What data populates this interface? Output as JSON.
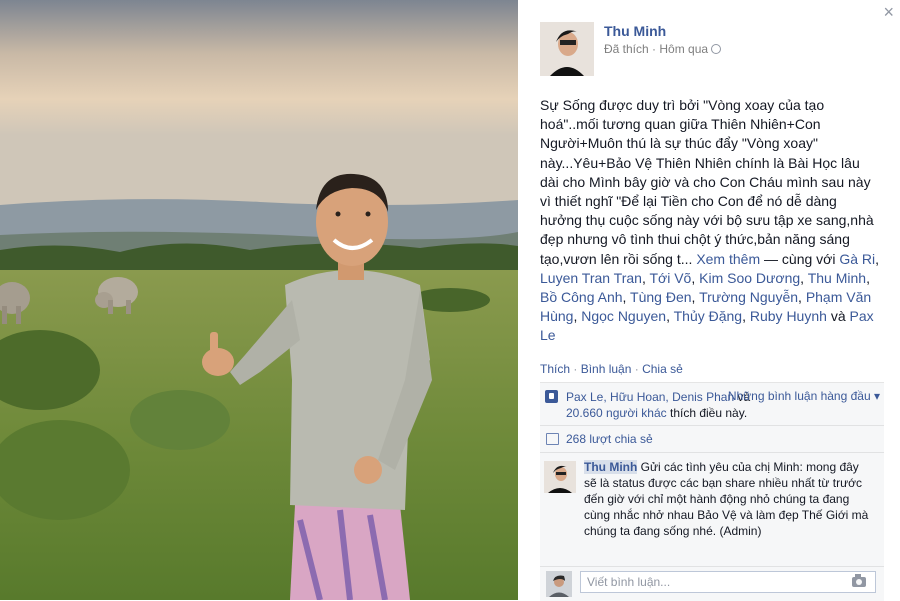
{
  "post": {
    "author": "Thu Minh",
    "liked": "Đã thích",
    "separator": " · ",
    "time": "Hôm qua",
    "body_text": "Sự Sống được duy trì bởi \"Vòng xoay của tạo hoá\"..mối tương quan giữa Thiên Nhiên+Con Người+Muôn thú là sự thúc đẩy \"Vòng xoay\" này...Yêu+Bảo Vệ Thiên Nhiên chính là Bài Học lâu dài cho Mình bây giờ và cho Con Cháu mình sau này vì thiết nghĩ \"Để lại Tiền cho Con để nó dễ dàng hưởng thụ cuộc sống này với bộ sưu tập xe sang,nhà đẹp nhưng vô tình thui chột ý thức,bản năng sáng tạo,vươn lên rồi sống t...",
    "see_more": "Xem thêm",
    "with_prefix": "— cùng với",
    "tagged": [
      "Gà Ri",
      "Luyen Tran Tran",
      "Tới Võ",
      "Kim Soo Dương",
      "Thu Minh",
      "Bồ Công Anh",
      "Tùng Đen",
      "Trường Nguyễn",
      "Phạm Văn Hùng",
      "Ngọc Nguyen",
      "Thủy Đặng",
      "Ruby Huynh"
    ],
    "and_word": "và",
    "last_tagged": "Pax Le"
  },
  "actions": {
    "like": "Thích",
    "comment": "Bình luận",
    "share": "Chia sẻ",
    "dot": " · "
  },
  "likes": {
    "names": "Pax Le, Hữu Hoan,",
    "names2": "Denis Phan",
    "and": "và",
    "others": "20.660 người khác",
    "suffix": "thích điều này.",
    "top_comments": "Những bình luận hàng đầu ▾"
  },
  "shares": {
    "text": "268 lượt chia sẻ"
  },
  "comment": {
    "author": "Thu Minh",
    "text": "Gửi các tình yêu của chị Minh: mong đây sẽ là status được các bạn share nhiều nhất từ trước đến giờ với chỉ một hành động nhỏ chúng ta đang cùng nhắc nhở nhau Bảo Vệ và làm đẹp Thế Giới mà chúng ta đang sống nhé. (Admin)"
  },
  "write_comment": {
    "placeholder": "Viết bình luận..."
  },
  "close_symbol": "×",
  "colors": {
    "link": "#3b5998",
    "panel_bg": "#ffffff",
    "ufi_bg": "#f6f7f8"
  }
}
